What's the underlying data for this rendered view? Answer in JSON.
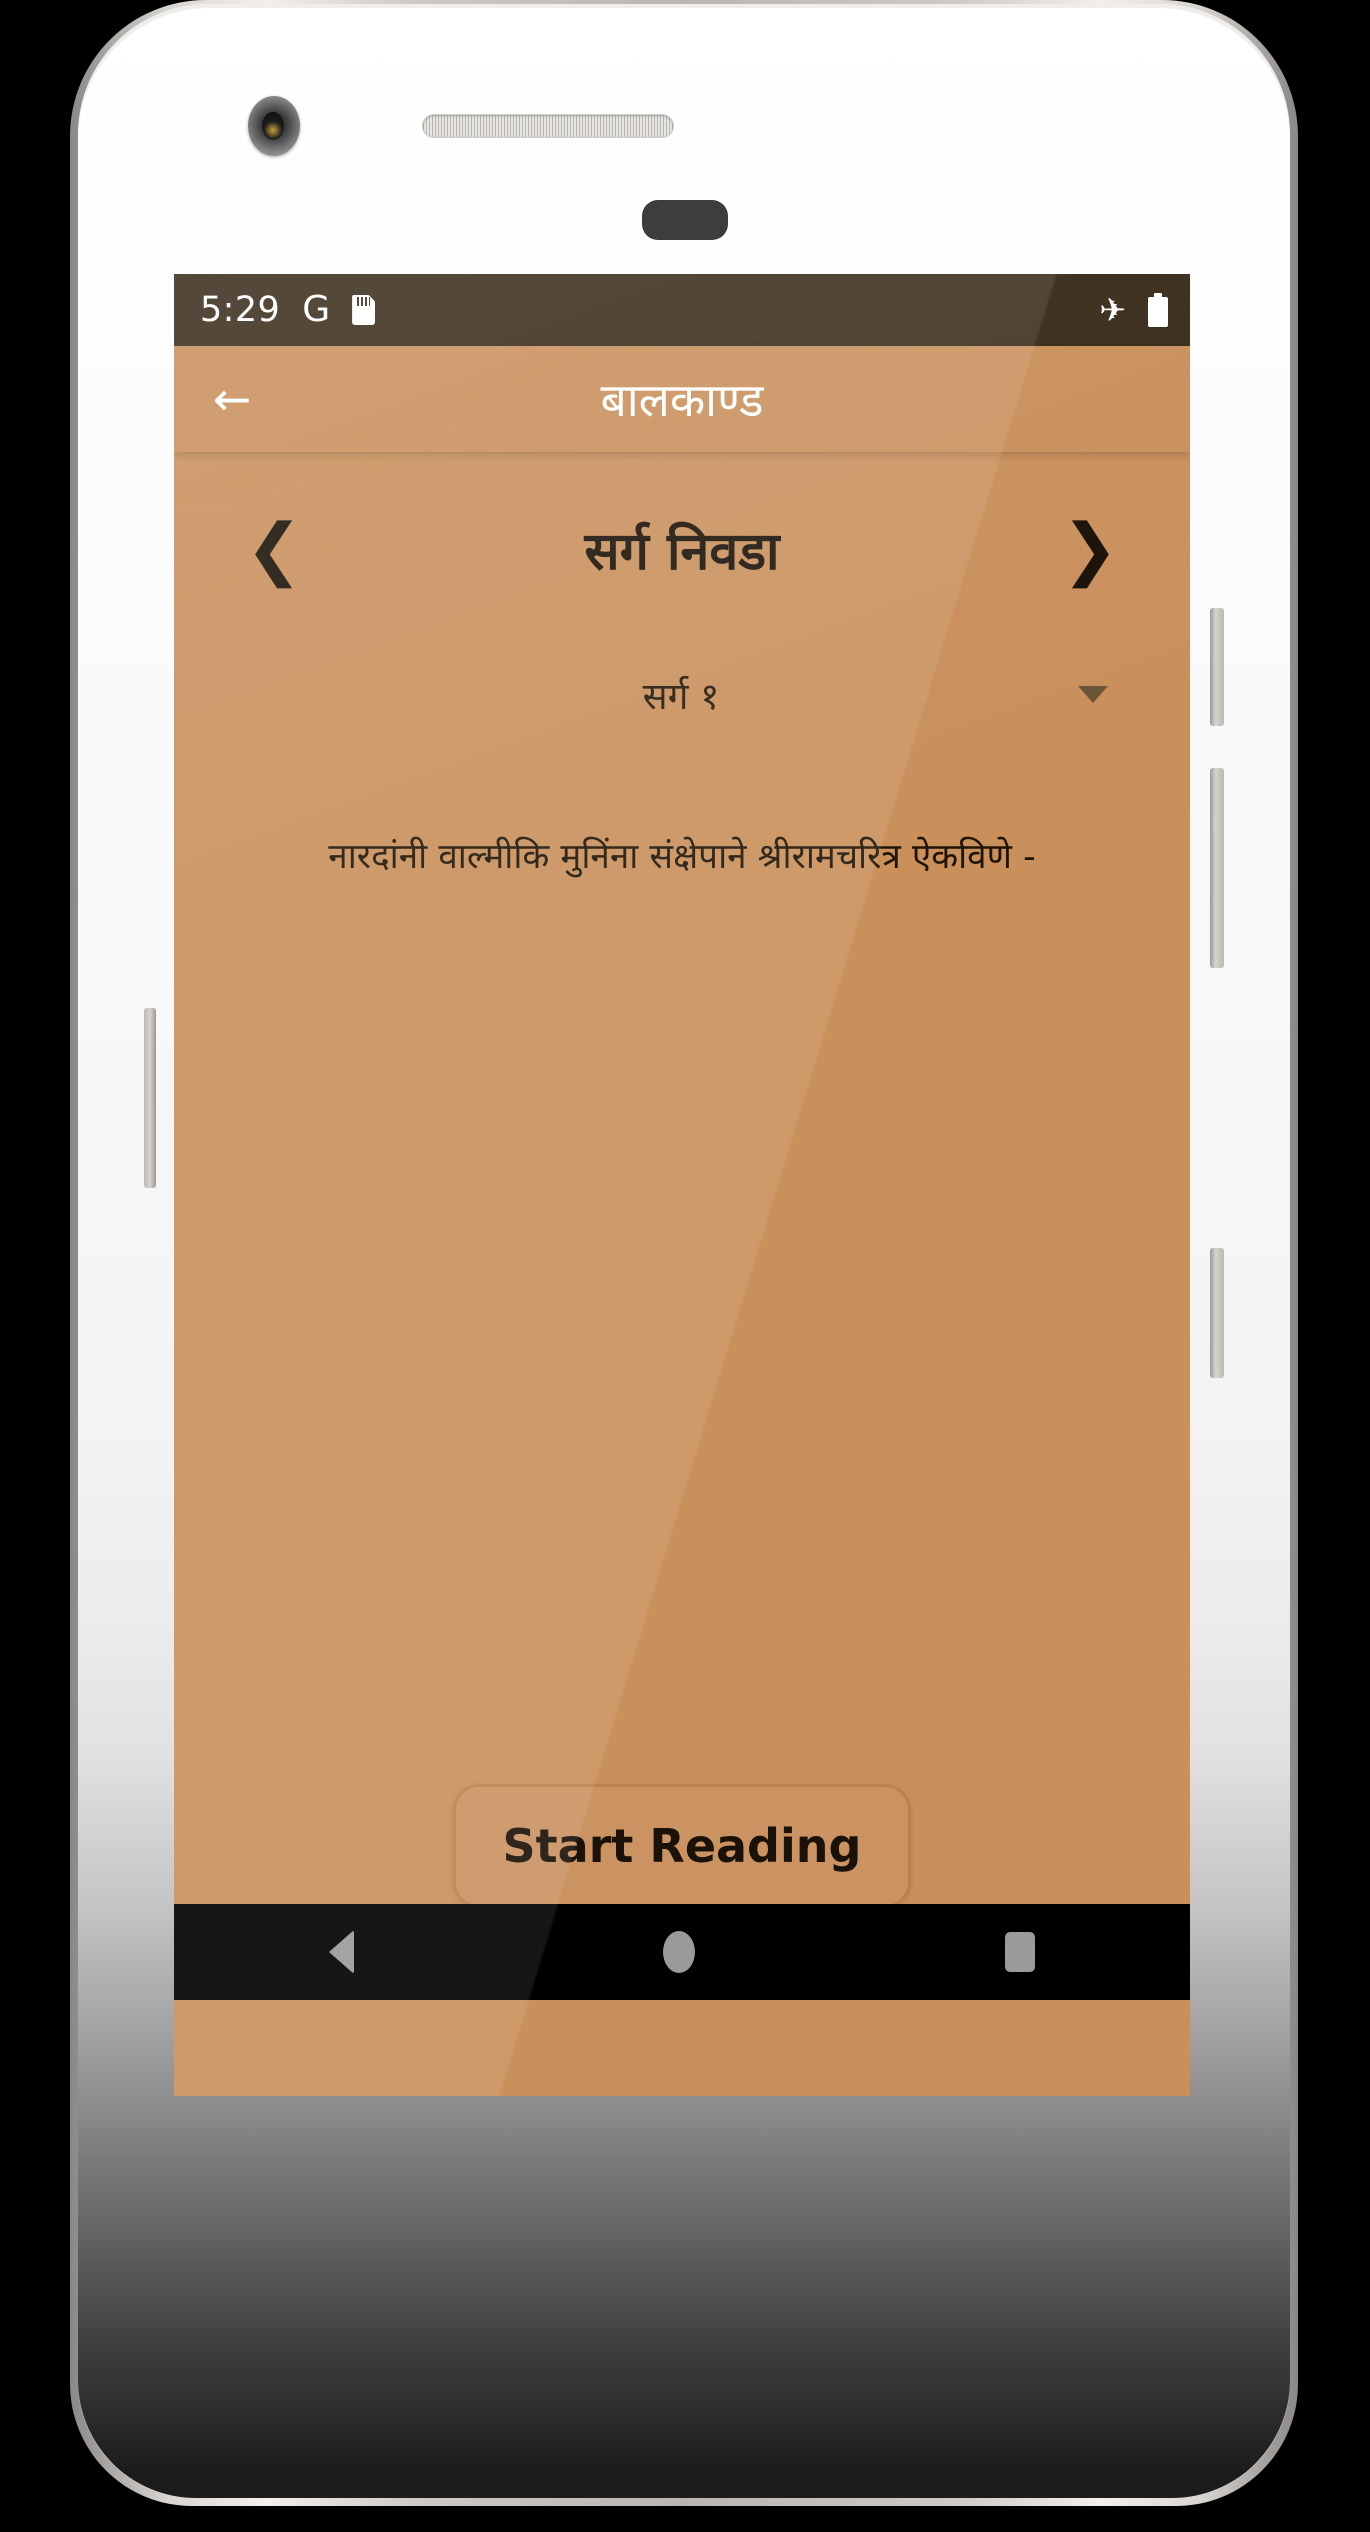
{
  "status_bar": {
    "time": "5:29",
    "google_icon": "G",
    "sd_card_icon": "sd-card-icon",
    "airplane_icon": "✈",
    "battery_icon": "battery-full-icon",
    "background_color": "#3b2d1c"
  },
  "app_bar": {
    "back_icon": "←",
    "title": "बालकाण्ड",
    "background_color": "#c9905c",
    "title_color": "#ffffff"
  },
  "main": {
    "prev_icon": "❮",
    "next_icon": "❯",
    "section_title": "सर्ग निवडा",
    "dropdown": {
      "selected": "सर्ग १",
      "caret_icon": "chevron-down-icon"
    },
    "description": "नारदांनी वाल्मीकि मुनिंना संक्षेपाने श्रीरामचरित्र ऐकविणे -",
    "start_button_label": "Start Reading",
    "background_color": "#c9905c",
    "text_color": "#1a1208"
  },
  "nav_bar": {
    "back_icon": "nav-back-triangle-icon",
    "home_icon": "nav-home-circle-icon",
    "recents_icon": "nav-recents-square-icon",
    "background_color": "#000000"
  },
  "device": {
    "camera_icon": "front-camera-icon",
    "earpiece_icon": "earpiece-speaker-icon",
    "proximity_icon": "proximity-sensor-icon"
  }
}
